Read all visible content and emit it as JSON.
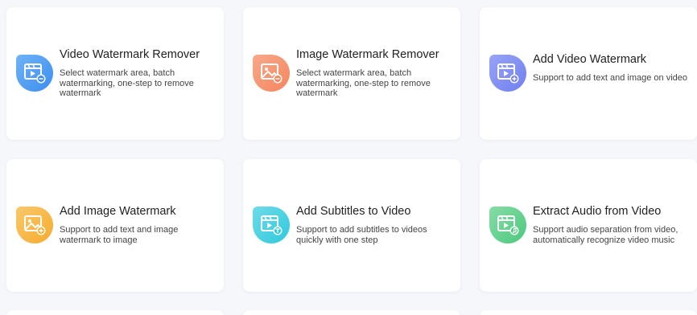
{
  "tools": [
    {
      "title": "Video Watermark Remover",
      "desc": "Select watermark area, batch watermarking, one-step to remove watermark",
      "icon": "video-remove-icon",
      "color": "#3d8ef0",
      "color_light": "#6fb2f7"
    },
    {
      "title": "Image Watermark Remover",
      "desc": "Select watermark area, batch watermarking, one-step to remove watermark",
      "icon": "image-remove-icon",
      "color": "#f4855e",
      "color_light": "#f8a98a"
    },
    {
      "title": "Add Video Watermark",
      "desc": "Support to add text and image on video",
      "icon": "video-add-icon",
      "color": "#6f7ff0",
      "color_light": "#98a4f6"
    },
    {
      "title": "Add Image Watermark",
      "desc": "Support to add text and image watermark to image",
      "icon": "image-add-icon",
      "color": "#f6ac2e",
      "color_light": "#f9c86a"
    },
    {
      "title": "Add Subtitles to Video",
      "desc": "Support to add subtitles to videos quickly with one step",
      "icon": "video-subtitle-icon",
      "color": "#2fc9dd",
      "color_light": "#6fdbe8"
    },
    {
      "title": "Extract Audio from Video",
      "desc": "Support audio separation from video, automatically recognize video music",
      "icon": "video-audio-icon",
      "color": "#4cc97e",
      "color_light": "#86dca6"
    }
  ]
}
